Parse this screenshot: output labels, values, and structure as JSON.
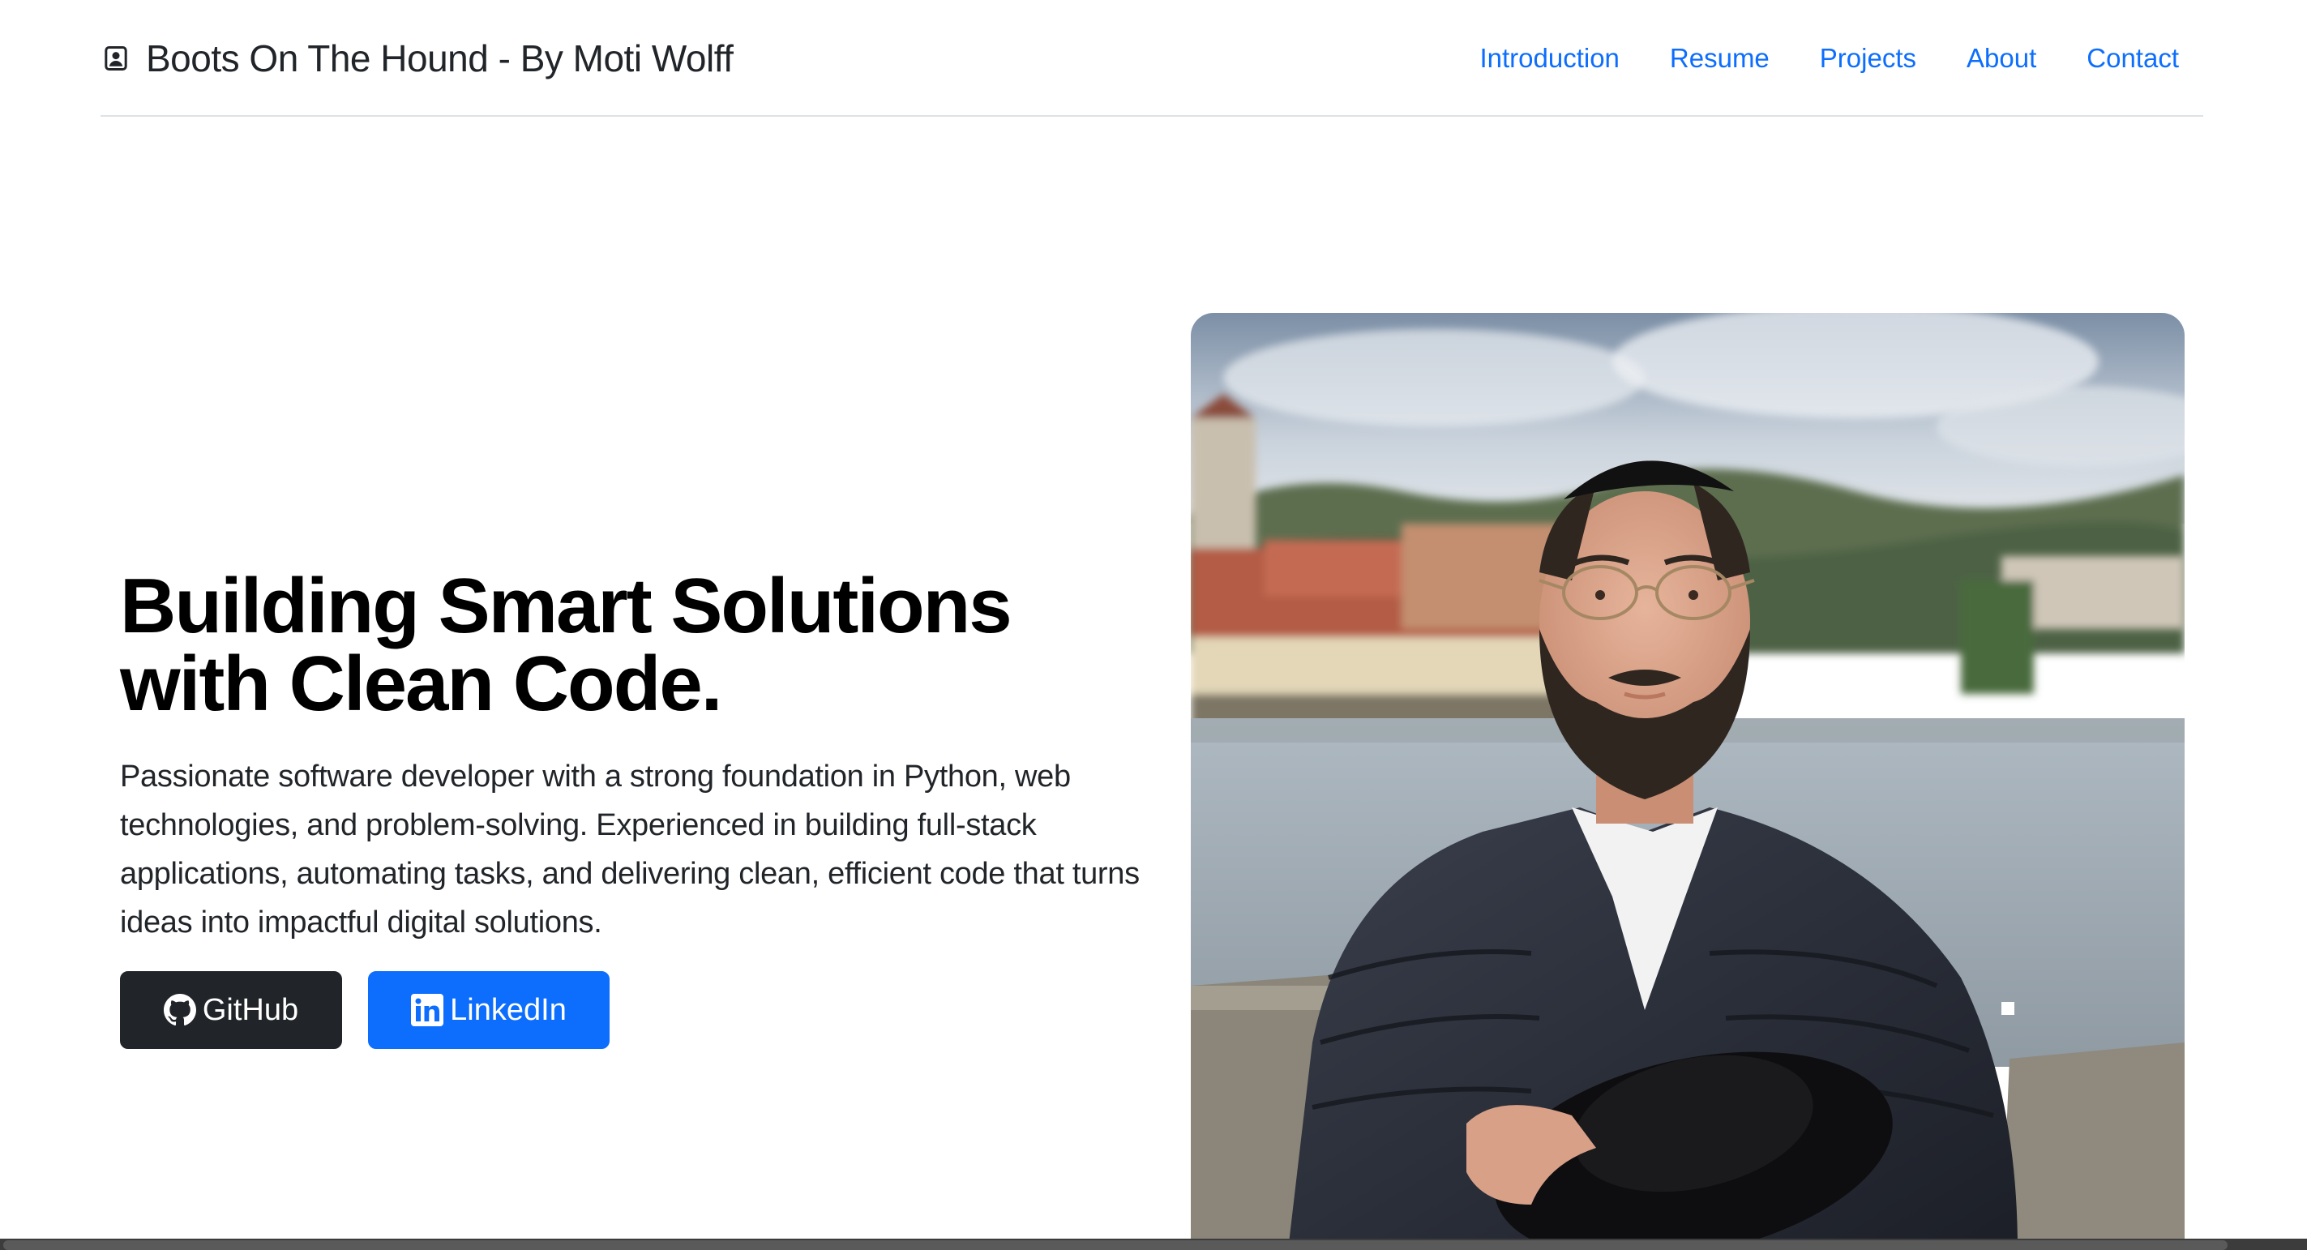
{
  "header": {
    "brand": "Boots On The Hound - By Moti Wolff",
    "brand_icon": "person-badge-icon",
    "nav": [
      {
        "label": "Introduction"
      },
      {
        "label": "Resume"
      },
      {
        "label": "Projects"
      },
      {
        "label": "About"
      },
      {
        "label": "Contact"
      }
    ]
  },
  "hero": {
    "title_line1": "Building Smart Solutions",
    "title_line2": "with Clean Code.",
    "lead": "Passionate software developer with a strong foundation in Python, web technologies, and problem-solving. Experienced in building full-stack applications, automating tasks, and delivering clean, efficient code that turns ideas into impactful digital solutions.",
    "buttons": {
      "github": {
        "label": "GitHub",
        "icon": "github-icon"
      },
      "linkedin": {
        "label": "LinkedIn",
        "icon": "linkedin-icon"
      }
    }
  },
  "colors": {
    "link": "#0d6efd",
    "dark_button": "#212529",
    "primary_button": "#0d6efd"
  }
}
